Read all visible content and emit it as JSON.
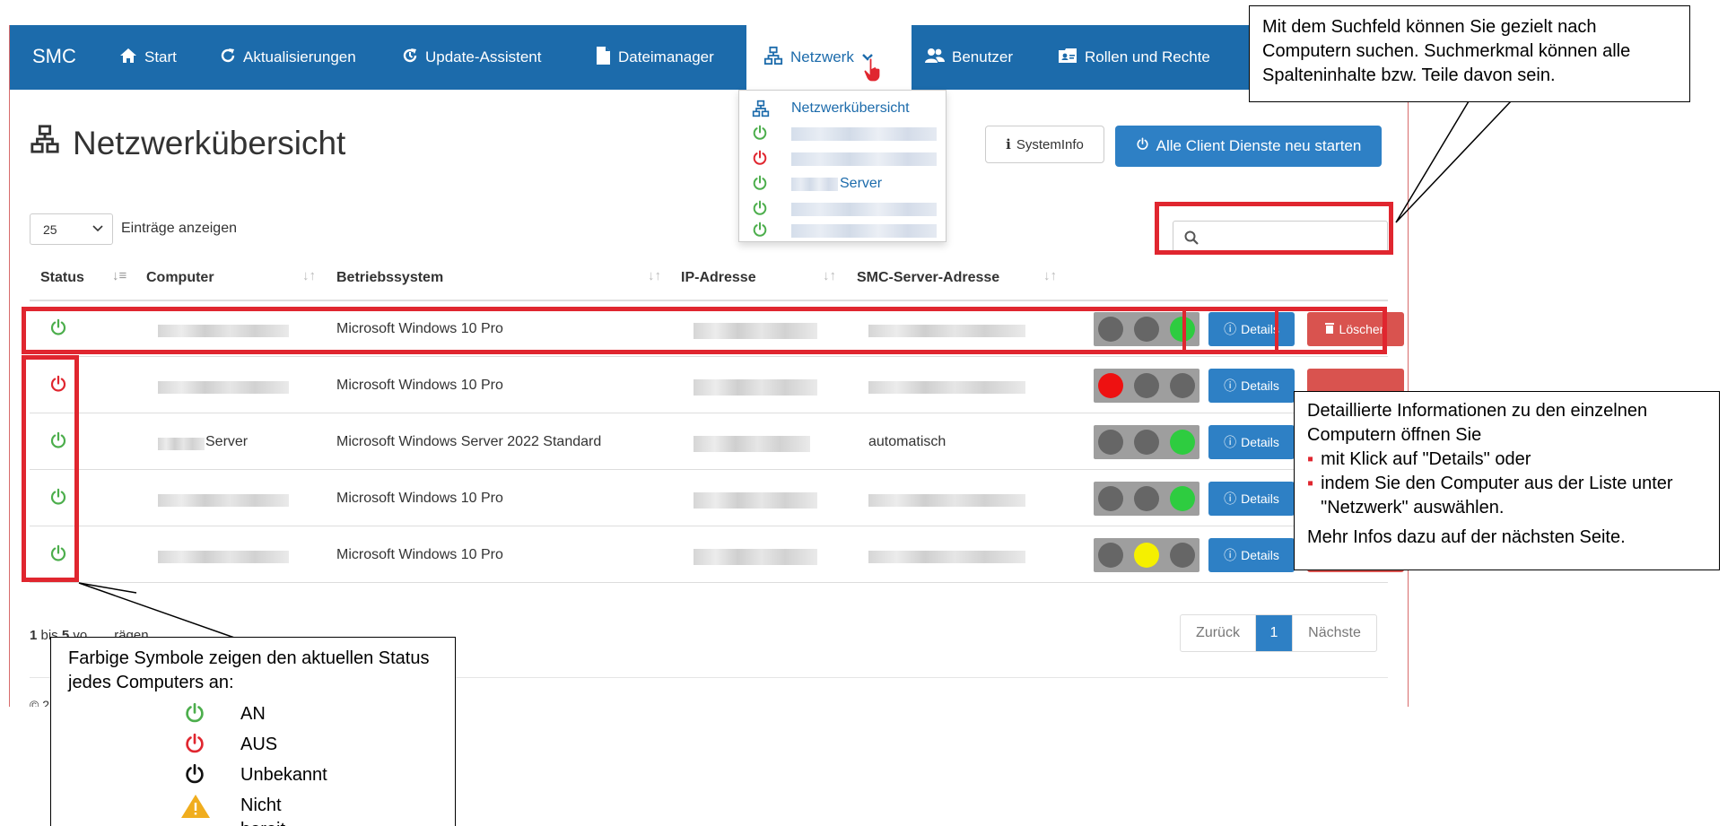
{
  "navbar": {
    "brand": "SMC",
    "items": [
      {
        "label": "Start",
        "icon": "home-icon"
      },
      {
        "label": "Aktualisierungen",
        "icon": "refresh-icon"
      },
      {
        "label": "Update-Assistent",
        "icon": "update-assistant-icon"
      },
      {
        "label": "Dateimanager",
        "icon": "file-icon"
      },
      {
        "label": "Netzwerk",
        "icon": "network-icon",
        "active": true
      },
      {
        "label": "Benutzer",
        "icon": "users-icon"
      },
      {
        "label": "Rollen und Rechte",
        "icon": "id-card-icon"
      }
    ]
  },
  "network_menu": {
    "title": "Netzwerkübersicht",
    "items": [
      {
        "status": "on",
        "label": ""
      },
      {
        "status": "off",
        "label": ""
      },
      {
        "status": "on",
        "label": "Server"
      },
      {
        "status": "on",
        "label": ""
      },
      {
        "status": "on",
        "label": ""
      }
    ]
  },
  "page": {
    "title": "Netzwerkübersicht",
    "sysinfo_button": "SystemInfo",
    "restart_button": "Alle Client Dienste neu starten",
    "page_size": "25",
    "entries_label": "Einträge anzeigen",
    "search_value": ""
  },
  "table": {
    "columns": [
      "Status",
      "Computer",
      "Betriebssystem",
      "IP-Adresse",
      "SMC-Server-Adresse"
    ],
    "rows": [
      {
        "status": "on",
        "computer": "",
        "os": "Microsoft Windows 10 Pro",
        "ip": "",
        "server": "",
        "lights": [
          "off",
          "off",
          "green"
        ]
      },
      {
        "status": "off",
        "computer": "",
        "os": "Microsoft Windows 10 Pro",
        "ip": "",
        "server": "",
        "lights": [
          "red",
          "off",
          "off"
        ]
      },
      {
        "status": "on",
        "computer": "Server",
        "os": "Microsoft Windows Server 2022 Standard",
        "ip": "",
        "server": "automatisch",
        "lights": [
          "off",
          "off",
          "green"
        ]
      },
      {
        "status": "on",
        "computer": "",
        "os": "Microsoft Windows 10 Pro",
        "ip": "",
        "server": "",
        "lights": [
          "off",
          "off",
          "green"
        ]
      },
      {
        "status": "on",
        "computer": "",
        "os": "Microsoft Windows 10 Pro",
        "ip": "",
        "server": "",
        "lights": [
          "off",
          "yellow",
          "off"
        ]
      }
    ],
    "details_label": "Details",
    "delete_label": "Löschen"
  },
  "footer": {
    "info_start": "1",
    "info_mid": " bis ",
    "info_end": "5",
    "info_rest": " vo",
    "info_tail": "rägen",
    "prev": "Zurück",
    "page": "1",
    "next": "Nächste",
    "copyright": "© 2"
  },
  "callouts": {
    "search": "Mit dem Suchfeld können Sie gezielt nach Computern suchen. Suchmerkmal können alle Spalteninhalte bzw. Teile davon sein.",
    "details_intro": "Detaillierte Informationen zu den einzelnen Computern öffnen Sie",
    "details_bullet1": "mit Klick auf \"Details\" oder",
    "details_bullet2": "indem Sie den Computer aus der Liste unter \"Netzwerk\" auswählen.",
    "details_more": "Mehr Infos dazu auf der nächsten Seite.",
    "status_intro": "Farbige Symbole zeigen den aktuellen Status jedes Computers an:",
    "legend": [
      {
        "label": "AN",
        "icon": "power-icon",
        "color": "#4cae4c"
      },
      {
        "label": "AUS",
        "icon": "power-icon",
        "color": "#e0262f"
      },
      {
        "label": "Unbekannt",
        "icon": "power-icon",
        "color": "#111111"
      },
      {
        "label": "Nicht bereit",
        "icon": "warning-icon",
        "color": "#f0ad1e"
      }
    ]
  },
  "colors": {
    "navbar": "#1c6bab",
    "primary": "#2e80c5",
    "danger": "#d9534f",
    "status_on": "#4cae4c",
    "status_off": "#e0262f",
    "highlight": "#e0262f"
  }
}
